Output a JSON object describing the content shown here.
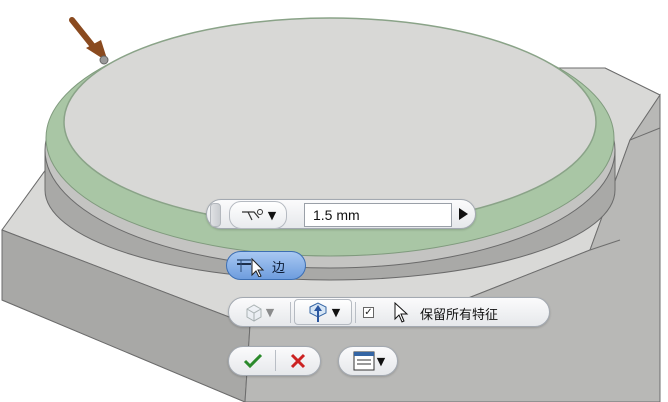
{
  "toolbar": {
    "thickness_value": "1.5 mm",
    "apply_to_label": "边",
    "keep_features_label": "保留所有特征",
    "keep_features_checked": true
  },
  "icons": {
    "grip": "grip-handle-icon",
    "measure": "measure-icon",
    "run": "run-arrow-icon",
    "edge_select": "edge-select-icon",
    "solid": "solid-body-icon",
    "shell_direction": "shell-direction-icon",
    "pointer": "cursor-arrow-icon",
    "ok": "checkmark-icon",
    "cancel": "cancel-x-icon",
    "menu": "options-menu-icon",
    "pin": "pin-arrow-icon"
  },
  "colors": {
    "selected_edge_green": "#a9c6a5",
    "face_gray": "#d8d8d6",
    "ok_green": "#2b8a2b",
    "cancel_red": "#cc2222",
    "active_blue": "#7aa7e0"
  }
}
